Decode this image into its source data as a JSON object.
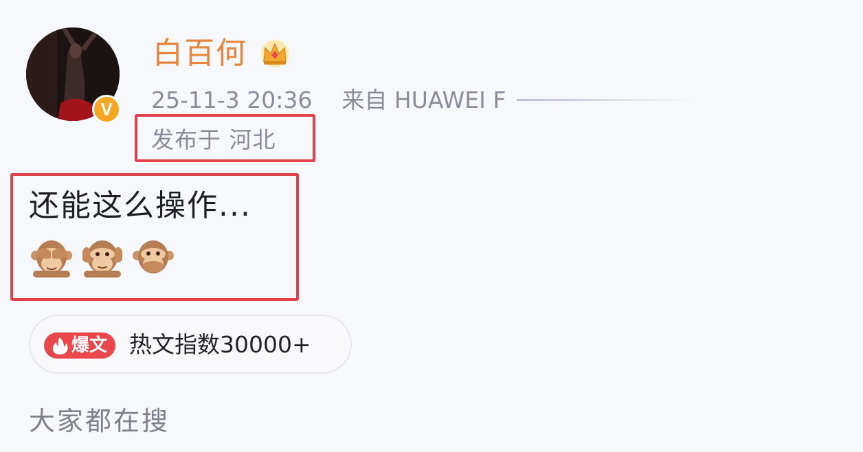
{
  "post": {
    "username": "白百何",
    "verified_badge": "V",
    "timestamp": "25-11-3 20:36",
    "source": "来自 HUAWEI F",
    "location": "发布于 河北",
    "text": "还能这么操作...",
    "emojis": [
      "see-no-evil-monkey",
      "hear-no-evil-monkey",
      "speak-no-evil-monkey"
    ],
    "hot_badge": "爆文",
    "hot_index": "热文指数30000+"
  },
  "section": {
    "search_label": "大家都在搜"
  },
  "colors": {
    "username": "#e8853d",
    "verified": "#f5a623",
    "highlight": "#e2434b",
    "hot_badge": "#e9474c",
    "meta_text": "#8a8c99"
  }
}
